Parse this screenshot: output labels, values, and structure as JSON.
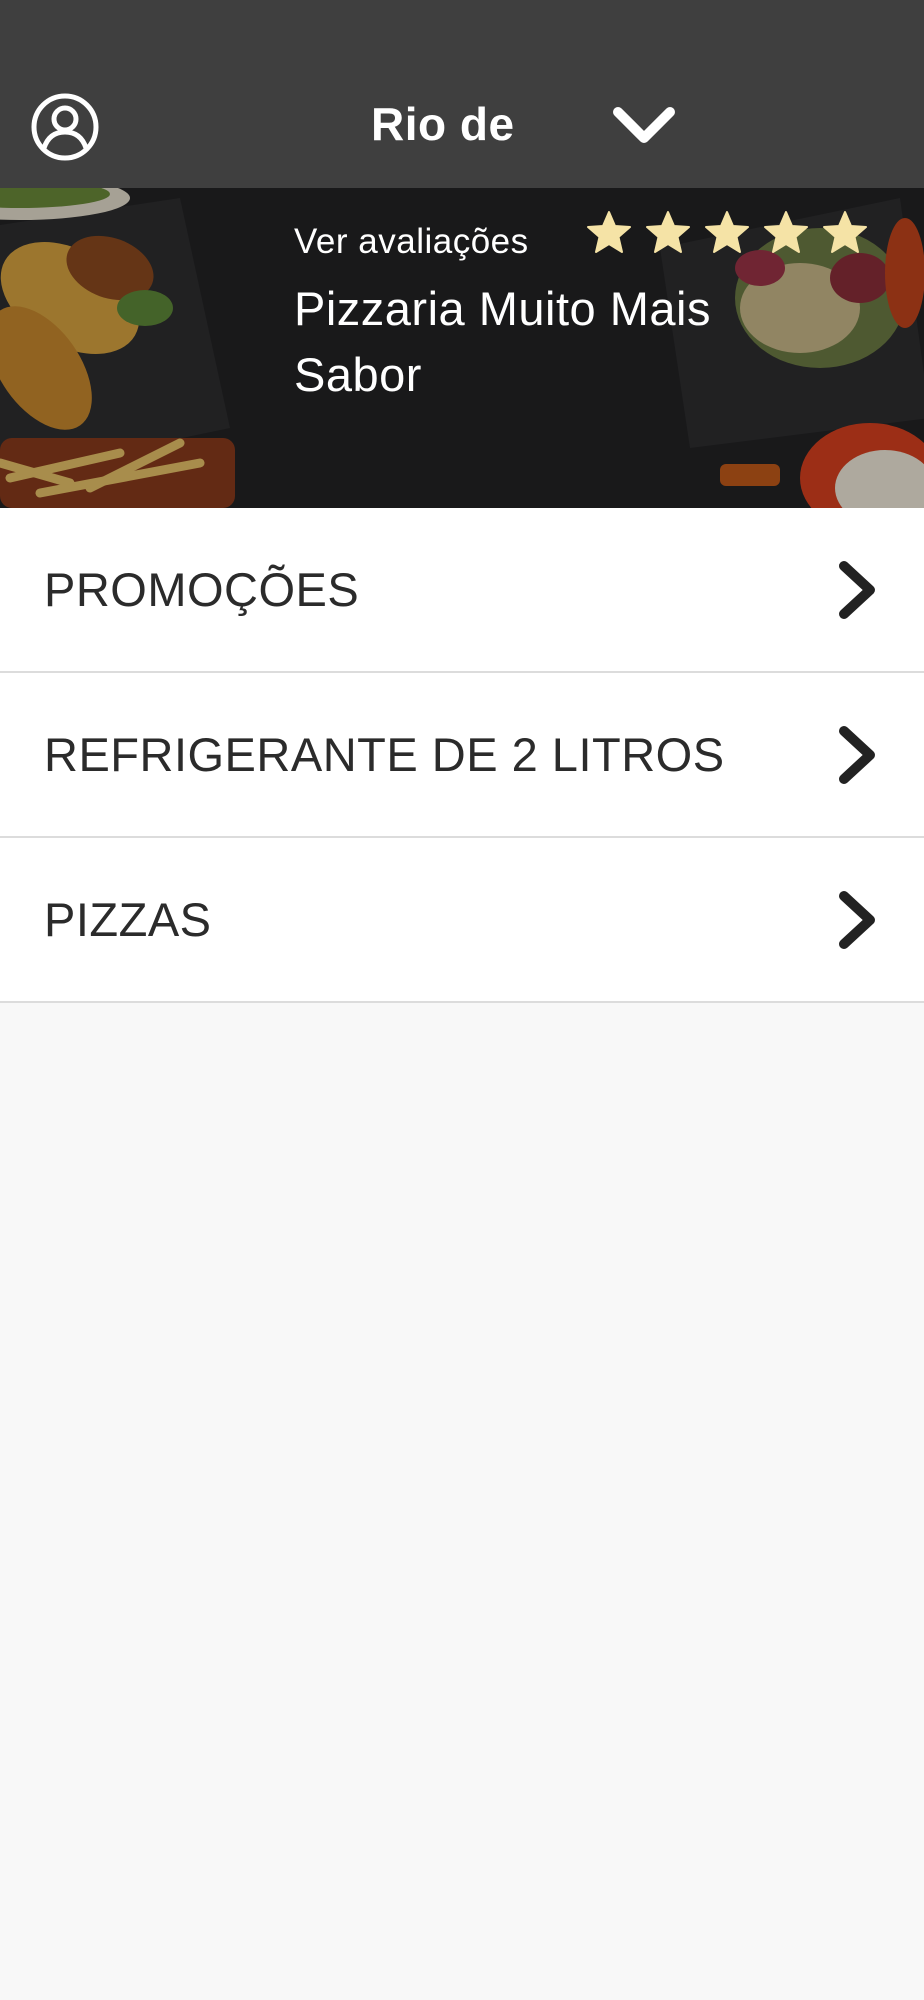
{
  "header": {
    "city": "Rio de",
    "profile_icon": "user-circle-icon",
    "dropdown_icon": "chevron-down-icon",
    "background_color": "#3f3f3f"
  },
  "restaurant": {
    "reviews_link": "Ver avaliações",
    "name": "Pizzaria Muito Mais Sabor",
    "rating": 5,
    "rating_max": 5,
    "star_color": "#f5e3a6"
  },
  "categories": [
    {
      "label": "PROMOÇÕES",
      "icon": "chevron-right-icon"
    },
    {
      "label": "REFRIGERANTE DE 2 LITROS",
      "icon": "chevron-right-icon"
    },
    {
      "label": "PIZZAS",
      "icon": "chevron-right-icon"
    }
  ]
}
